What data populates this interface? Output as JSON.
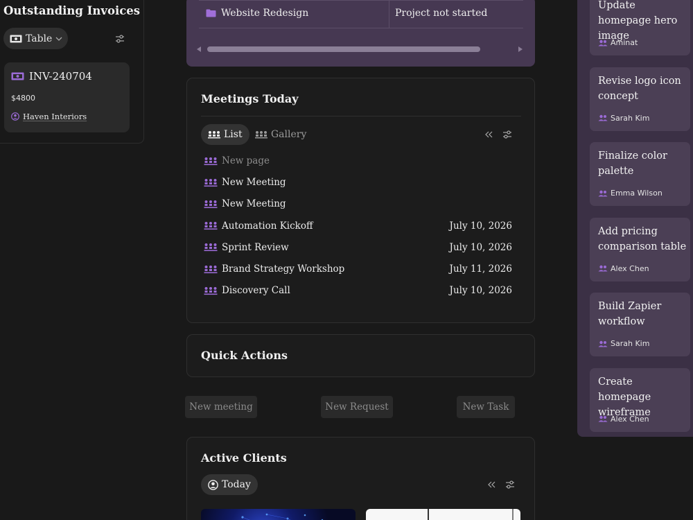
{
  "outstanding_invoices": {
    "title": "Outstanding Invoices",
    "view_label": "Table",
    "invoice": {
      "number": "INV-240704",
      "amount": "$4800",
      "client": "Haven Interiors"
    }
  },
  "projects_table": {
    "row": {
      "name": "Website Redesign",
      "status": "Project not started"
    }
  },
  "meetings": {
    "title": "Meetings Today",
    "tabs": {
      "list": "List",
      "gallery": "Gallery"
    },
    "rows": [
      {
        "name": "New page",
        "date": ""
      },
      {
        "name": "New Meeting",
        "date": ""
      },
      {
        "name": "New Meeting",
        "date": ""
      },
      {
        "name": "Automation Kickoff",
        "date": "July 10, 2026"
      },
      {
        "name": "Sprint Review",
        "date": "July 10, 2026"
      },
      {
        "name": "Brand Strategy Workshop",
        "date": "July 11, 2026"
      },
      {
        "name": "Discovery Call",
        "date": "July 10, 2026"
      }
    ]
  },
  "quick_actions": {
    "title": "Quick Actions",
    "buttons": {
      "meeting": "New meeting",
      "request": "New Request",
      "task": "New Task"
    }
  },
  "active_clients": {
    "title": "Active Clients",
    "view_label": "Today"
  },
  "tasks": [
    {
      "title": "Update homepage hero image",
      "person": "Aminat"
    },
    {
      "title": "Revise logo icon concept",
      "person": "Sarah Kim"
    },
    {
      "title": " Finalize color palette",
      "person": "Emma Wilson"
    },
    {
      "title": "Add pricing comparison table",
      "person": "Alex Chen"
    },
    {
      "title": " Build Zapier workflow",
      "person": "Sarah Kim"
    },
    {
      "title": " Create homepage wireframe",
      "person": "Alex Chen"
    }
  ],
  "colors": {
    "accent_purple": "#9b6bd6",
    "purple_table_bg": "#463852",
    "right_panel_bg": "#3b3045",
    "task_card_bg": "#4b3f55",
    "page_bg": "#191919"
  }
}
